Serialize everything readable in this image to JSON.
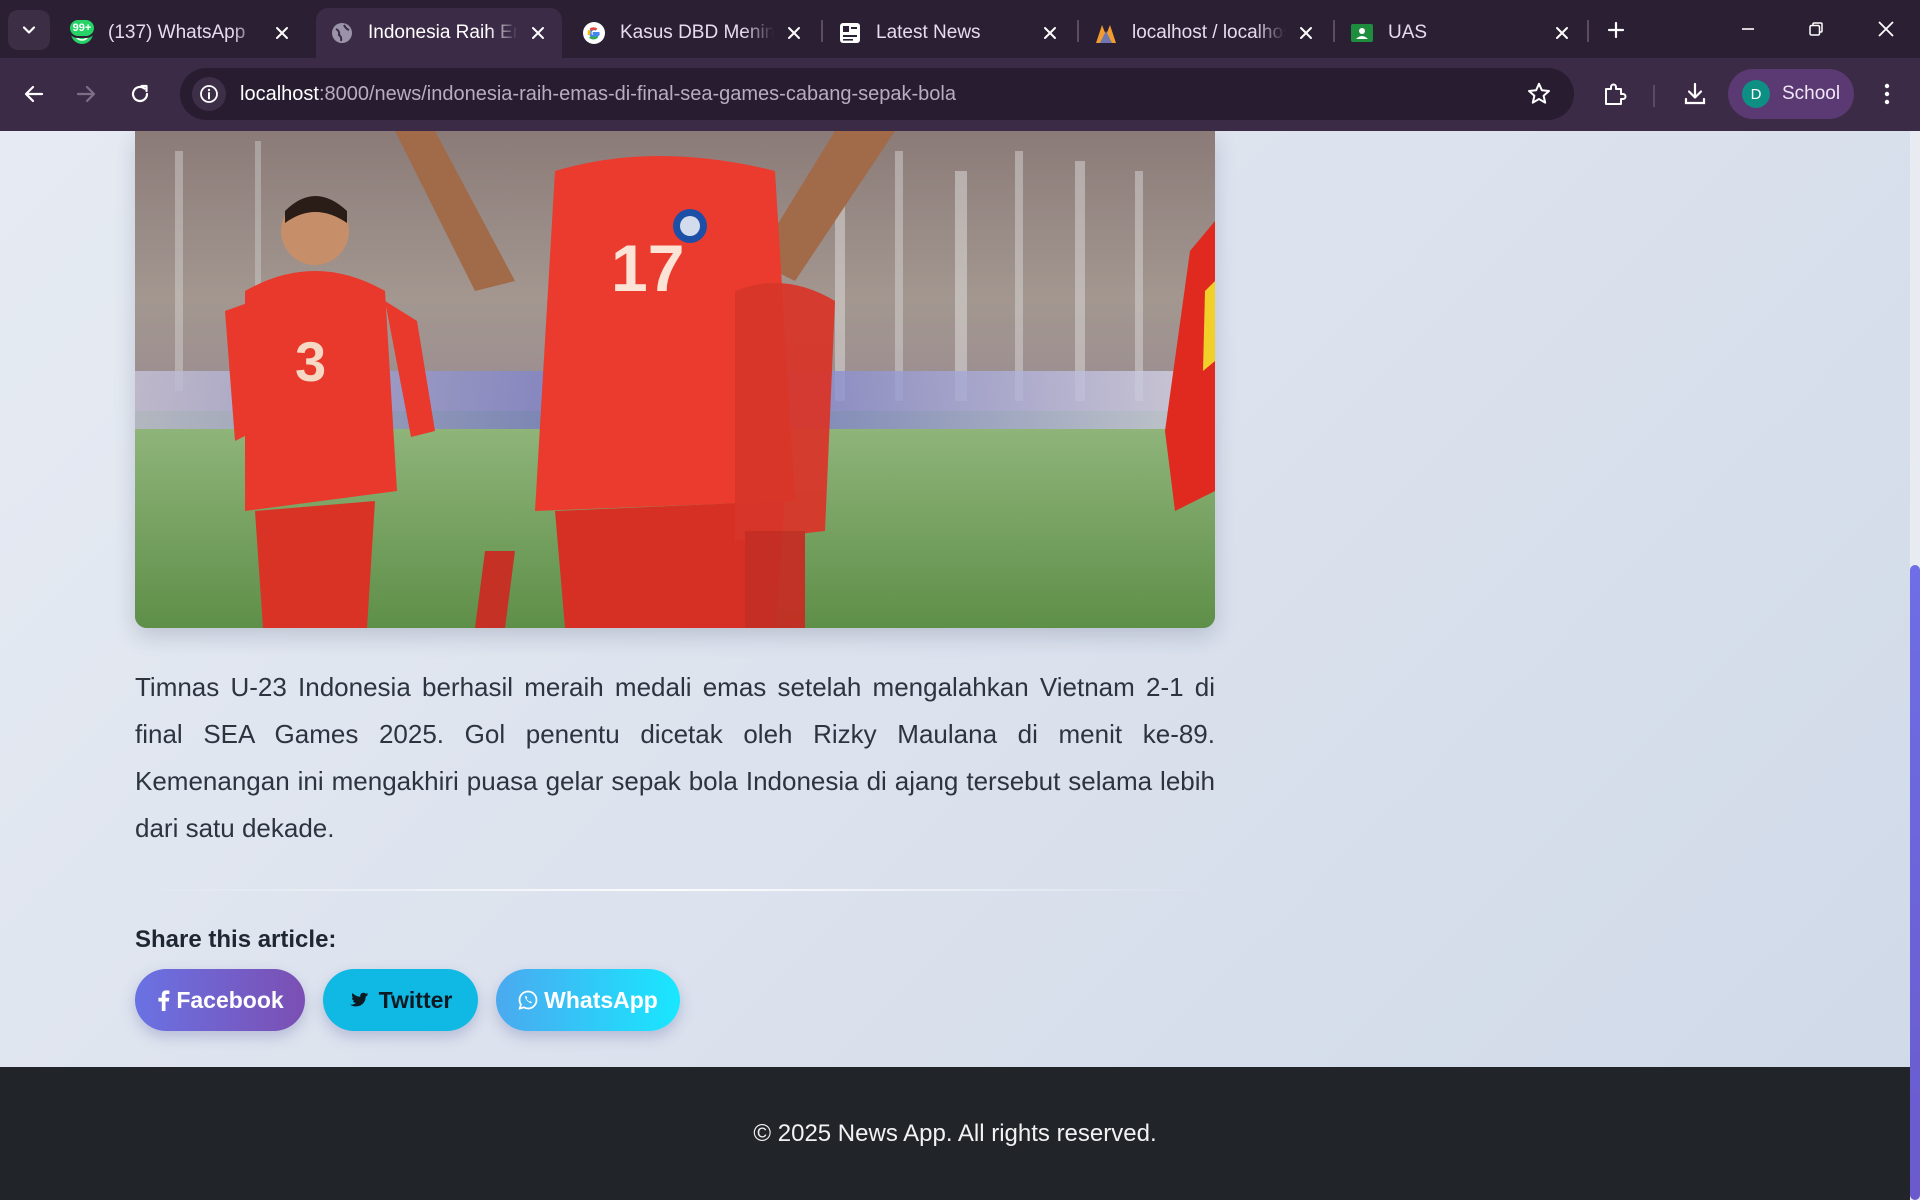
{
  "browser": {
    "tabs": [
      {
        "title": "(137) WhatsApp",
        "favicon": "whatsapp-icon",
        "active": false
      },
      {
        "title": "Indonesia Raih Emas di Final SEA Games",
        "favicon": "globe-icon",
        "active": true
      },
      {
        "title": "Kasus DBD Meningkat",
        "favicon": "google-icon",
        "active": false
      },
      {
        "title": "Latest News",
        "favicon": "news-icon",
        "active": false
      },
      {
        "title": "localhost / localhost",
        "favicon": "phpmyadmin-icon",
        "active": false
      },
      {
        "title": "UAS",
        "favicon": "classroom-icon",
        "active": false
      }
    ],
    "whatsapp_badge": "99+",
    "url_host": "localhost",
    "url_rest": ":8000/news/indonesia-raih-emas-di-final-sea-games-cabang-sepak-bola",
    "profile": {
      "initial": "D",
      "name": "School"
    }
  },
  "article": {
    "hero_image_alt": "Timnas U-23 Indonesia celebrating",
    "jersey_numbers": [
      "17",
      "3"
    ],
    "body": "Timnas U-23 Indonesia berhasil meraih medali emas setelah mengalahkan Vietnam 2-1 di final SEA Games 2025. Gol penentu dicetak oleh Rizky Maulana di menit ke-89. Kemenangan ini mengakhiri puasa gelar sepak bola Indonesia di ajang tersebut selama lebih dari satu dekade.",
    "share_title": "Share this article:",
    "share_buttons": {
      "facebook": "Facebook",
      "twitter": "Twitter",
      "whatsapp": "WhatsApp"
    }
  },
  "footer": {
    "text": "© 2025 News App. All rights reserved."
  },
  "colors": {
    "accent_purple": "#6a5acd",
    "footer_bg": "#212529",
    "tab_bg": "#2b1f33"
  }
}
